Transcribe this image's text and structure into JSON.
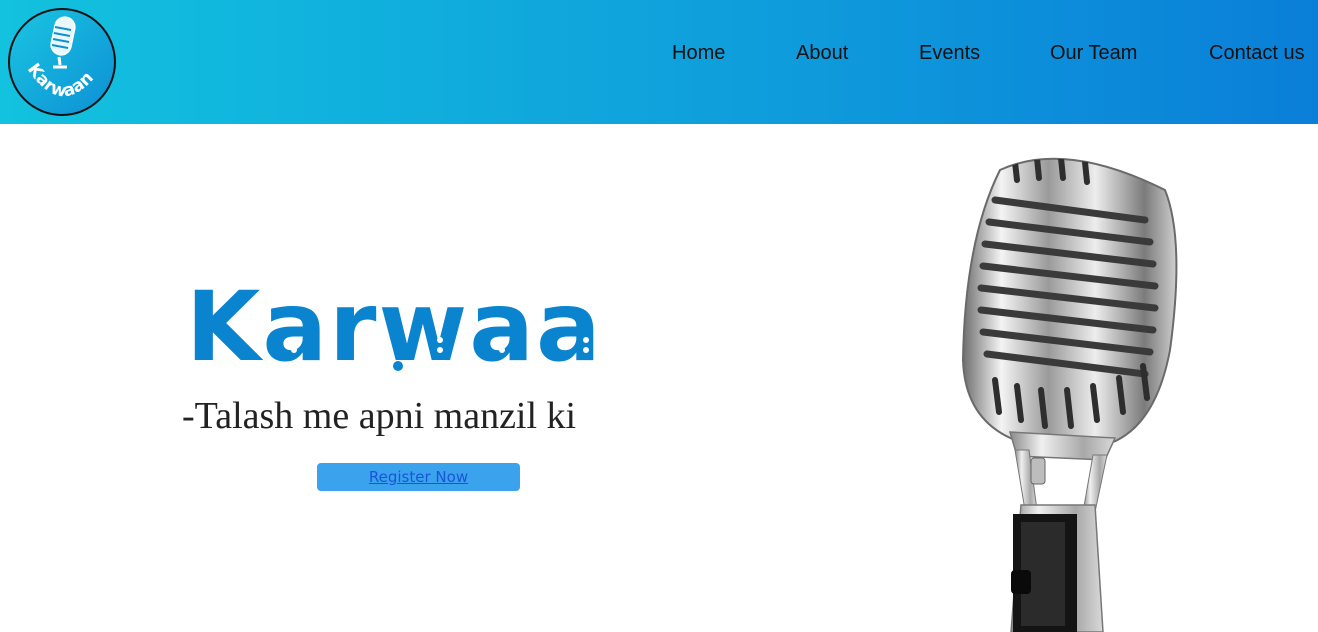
{
  "site": {
    "logo_text": "Karwaan",
    "brand_color": "#0a84cf",
    "header_gradient": [
      "#12c2de",
      "#0a7fd8"
    ]
  },
  "nav": {
    "items": [
      {
        "label": "Home"
      },
      {
        "label": "About"
      },
      {
        "label": "Events"
      },
      {
        "label": "Our Team"
      },
      {
        "label": "Contact us"
      }
    ]
  },
  "hero": {
    "wordmark": "Karwaan",
    "tagline": "-Talash me apni manzil ki",
    "register_label": "Register Now",
    "button_color": "#3ba3ee",
    "image": "microphone-image"
  }
}
